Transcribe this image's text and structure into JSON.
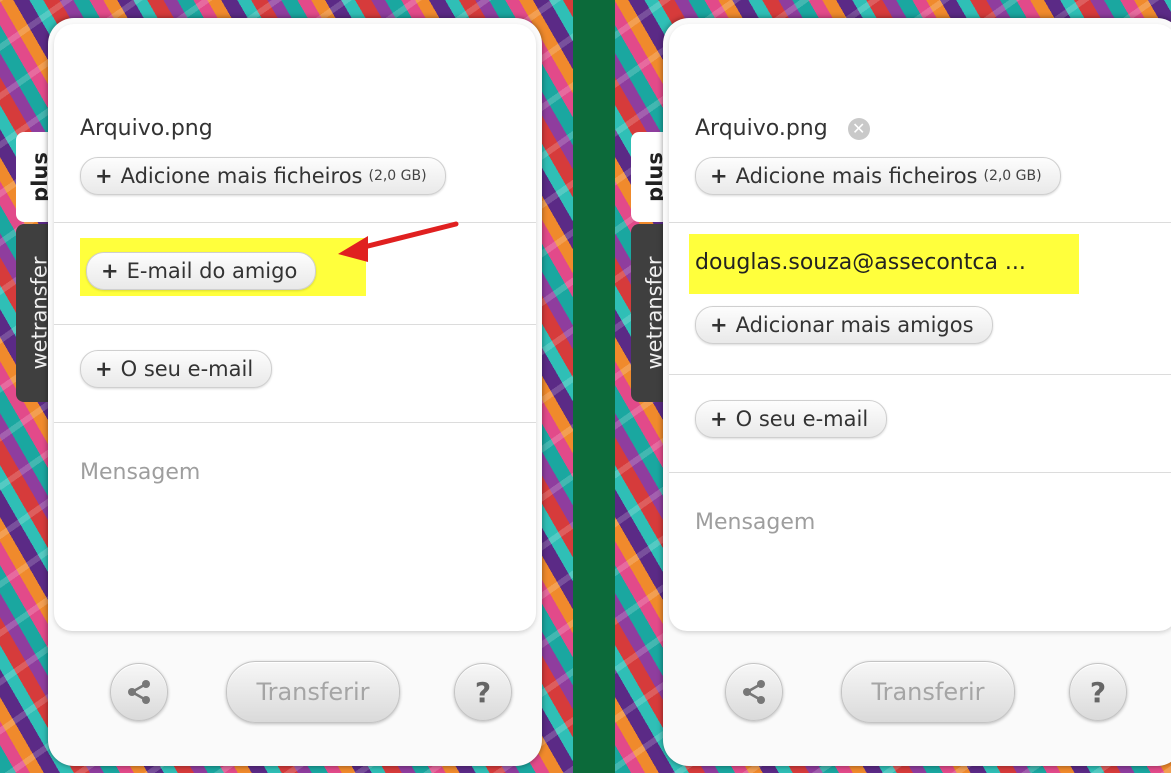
{
  "left_panel": {
    "side_tabs": {
      "plus": "plus",
      "wetransfer": "wetransfer"
    },
    "file_name": "Arquivo.png",
    "add_files": {
      "label": "Adicione mais ficheiros",
      "size": "(2,0 GB)"
    },
    "friend_email": "E-mail do amigo",
    "your_email": "O seu e-mail",
    "message_placeholder": "Mensagem",
    "transfer": "Transferir",
    "help": "?"
  },
  "right_panel": {
    "side_tabs": {
      "plus": "plus",
      "wetransfer": "wetransfer"
    },
    "file_name": "Arquivo.png",
    "add_files": {
      "label": "Adicione mais ficheiros",
      "size": "(2,0 GB)"
    },
    "recipient_email": "douglas.souza@assecontca ...",
    "add_more_friends": "Adicionar mais amigos",
    "your_email": "O seu e-mail",
    "message_placeholder": "Mensagem",
    "transfer": "Transferir",
    "help": "?"
  },
  "colors": {
    "page_bg": "#0c6a3a",
    "highlight": "#ffff3c",
    "arrow": "#e02020"
  }
}
